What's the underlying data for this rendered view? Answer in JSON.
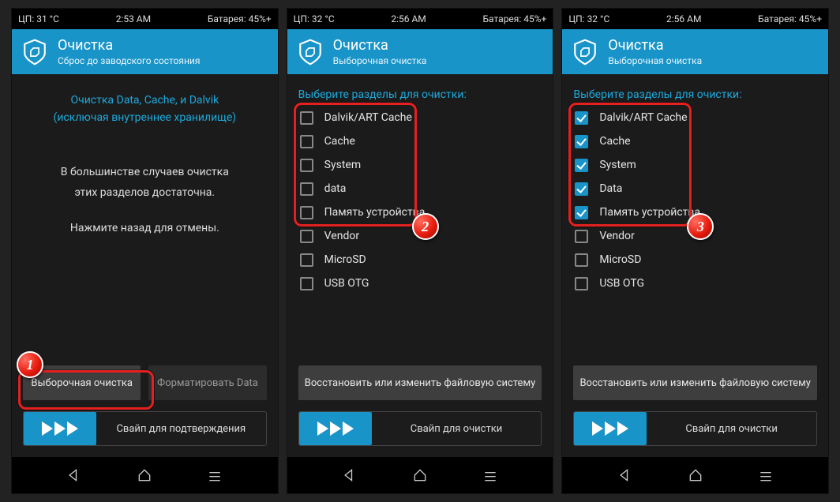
{
  "screens": [
    {
      "status": {
        "cpu": "ЦП: 31 °C",
        "time": "2:53 AM",
        "battery": "Батарея: 45%+"
      },
      "header": {
        "title": "Очистка",
        "subtitle": "Сброс до заводского состояния"
      },
      "info_teal_l1": "Очистка Data, Cache, и Dalvik",
      "info_teal_l2": "(исключая внутреннее хранилище)",
      "info_white_l1": "В большинстве случаев очистка",
      "info_white_l2": "этих разделов достаточна.",
      "info_white_l3": "Нажмите назад для отмены.",
      "btn_left": "Выборочная очистка",
      "btn_right": "Форматировать Data",
      "swipe_label": "Свайп для подтверждения",
      "badge": "1"
    },
    {
      "status": {
        "cpu": "ЦП: 32 °C",
        "time": "2:56 AM",
        "battery": "Батарея: 45%+"
      },
      "header": {
        "title": "Очистка",
        "subtitle": "Выборочная очистка"
      },
      "section_label": "Выберите разделы для очистки:",
      "items": [
        {
          "label": "Dalvik/ART Cache",
          "checked": false
        },
        {
          "label": "Cache",
          "checked": false
        },
        {
          "label": "System",
          "checked": false
        },
        {
          "label": "data",
          "checked": false
        },
        {
          "label": "Память устройства",
          "checked": false
        },
        {
          "label": "Vendor",
          "checked": false
        },
        {
          "label": "MicroSD",
          "checked": false
        },
        {
          "label": "USB OTG",
          "checked": false
        }
      ],
      "btn_full": "Восстановить или изменить файловую систему",
      "swipe_label": "Свайп для очистки",
      "badge": "2"
    },
    {
      "status": {
        "cpu": "ЦП: 32 °C",
        "time": "2:56 AM",
        "battery": "Батарея: 45%+"
      },
      "header": {
        "title": "Очистка",
        "subtitle": "Выборочная очистка"
      },
      "section_label": "Выберите разделы для очистки:",
      "items": [
        {
          "label": "Dalvik/ART Cache",
          "checked": true
        },
        {
          "label": "Cache",
          "checked": true
        },
        {
          "label": "System",
          "checked": true
        },
        {
          "label": "Data",
          "checked": true
        },
        {
          "label": "Память устройства",
          "checked": true
        },
        {
          "label": "Vendor",
          "checked": false
        },
        {
          "label": "MicroSD",
          "checked": false
        },
        {
          "label": "USB OTG",
          "checked": false
        }
      ],
      "btn_full": "Восстановить или изменить файловую систему",
      "swipe_label": "Свайп для очистки",
      "badge": "3"
    }
  ]
}
